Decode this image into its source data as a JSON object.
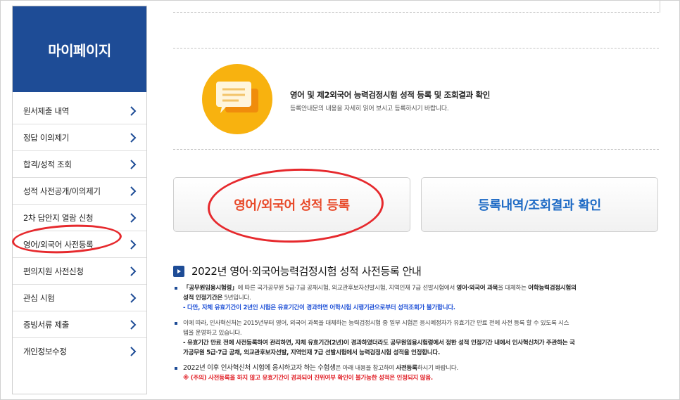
{
  "sidebar": {
    "title": "마이페이지",
    "items": [
      {
        "label": "원서제출 내역"
      },
      {
        "label": "정답 이의제기"
      },
      {
        "label": "합격/성적 조회"
      },
      {
        "label": "성적 사전공개/이의제기"
      },
      {
        "label": "2차 답안지 열람 신청"
      },
      {
        "label": "영어/외국어 사전등록"
      },
      {
        "label": "편의지원 사전신청"
      },
      {
        "label": "관심 시험"
      },
      {
        "label": "증빙서류 제출"
      },
      {
        "label": "개인정보수정"
      }
    ]
  },
  "intro": {
    "title": "영어 및 제2외국어 능력검정시험 성적 등록 및 조회결과 확인",
    "subtitle": "등록안내문의 내용을 자세히 읽어 보시고 등록하시기 바랍니다.",
    "icon": "chat-bubble-icon",
    "icon_color": "#f8b20f"
  },
  "buttons": {
    "register": "영어/외국어 성적 등록",
    "check": "등록내역/조회결과 확인"
  },
  "section": {
    "title": "2022년 영어·외국어능력검정시험 성적 사전등록 안내"
  },
  "notes": {
    "n1_a": "「공무원임용시험령」",
    "n1_b": "에 따른 국가공무원 5급·7급 공채시험, 외교관후보자선발시험, 지역인재 7급 선발시험에서 ",
    "n1_c": "영어·외국어 과목",
    "n1_d": "을 대체하는 ",
    "n1_e": "어학능력검정시험의",
    "n1_f": "성적 인정기간은",
    "n1_g": " 5년입니다.",
    "n1_h": "- 다만, 자체 유효기간이 2년인 시험은 유효기간이 경과하면 어학시험 시행기관으로부터 성적조회가 불가합니다.",
    "n2_a": "이에 따라, 인사혁신처는 2015년부터 영어, 외국어 과목을 대체하는 능력검정시험 중 일부 시험은 응시예정자가 유효기간 만료 전에 사전 등록 할 수 있도록 시스",
    "n2_b": "템을 운영하고 있습니다.",
    "n2_c": "- 유효기간 만료 전에 사전등록하여 관리하면, 자체 유효기간(2년)이 경과하였더라도 공무원임용시험령에서 정한 성적 인정기간 내에서 인사혁신처가 주관하는 국",
    "n2_d": "가공무원 5급·7급 공채, 외교관후보자선발, 지역인재 7급 선발시험에서 능력검정시험 성적을 인정합니다.",
    "n3_a": "2022년 이후 인사혁신처 시험에 응시하고자 하는 수험생",
    "n3_b": "은 아래 내용을 참고하여 ",
    "n3_c": "사전등록",
    "n3_d": "하시기 바랍니다.",
    "n3_e": "※ (주의) 사전등록을 하지 않고 유효기간이 경과되어 진위여부 확인이 불가능한 성적은 인정되지 않음."
  },
  "colors": {
    "brand": "#1e4c96",
    "register_text": "#e84a2a",
    "check_text": "#1f6bc5",
    "annotation": "#e6292d"
  }
}
